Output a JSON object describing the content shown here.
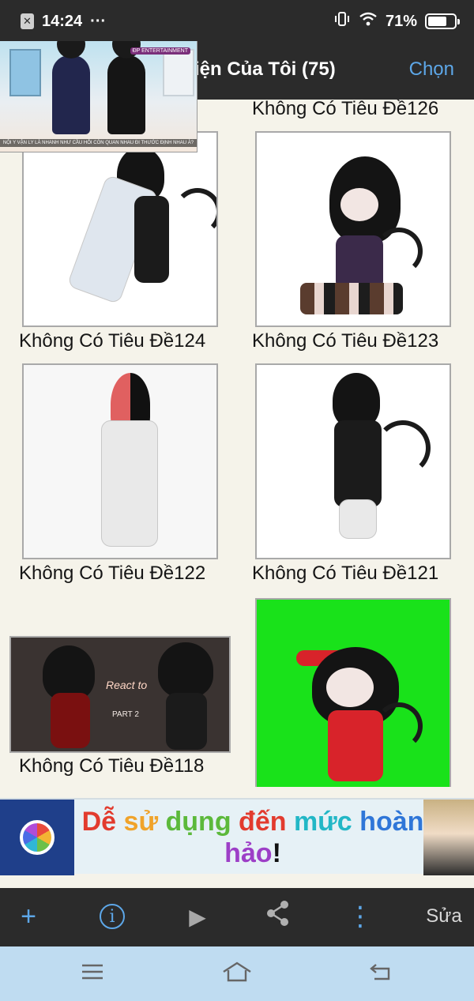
{
  "status_bar": {
    "time": "14:24",
    "more": "···",
    "battery": "71%",
    "battery_level": 0.71,
    "icons": [
      "close-box-icon",
      "vibrate-icon",
      "wifi-icon",
      "battery-icon"
    ]
  },
  "header": {
    "title": "iện Của Tôi (75)",
    "action": "Chọn"
  },
  "pip_video": {
    "logo": "ĐP ENTERTAINMENT",
    "caption": "NỘI Y VẬN LY LÀ NHANH NHƯ CẦU HỎI CÒN QUAN NHAU ĐI THƯỚC ĐỊNH NHAU À?"
  },
  "gallery": {
    "items": [
      {
        "label": "Không Có Tiêu Đề126"
      },
      {
        "label": "Không Có Tiêu Đề124"
      },
      {
        "label": "Không Có Tiêu Đề123"
      },
      {
        "label": "Không Có Tiêu Đề122"
      },
      {
        "label": "Không Có Tiêu Đề121"
      },
      {
        "label": "Không Có Tiêu Đề118"
      },
      {
        "label": "",
        "thumb_color": "#19e21a"
      }
    ],
    "thumb_text": {
      "react": "React to",
      "part": "PART 2"
    }
  },
  "ad": {
    "line1_words": [
      "Dễ",
      "sử",
      "dụng",
      "đến",
      "mức",
      "hoàn"
    ],
    "line2": "hảo",
    "line2_end": "!",
    "word_colors": [
      "#e23b2e",
      "#f0a32a",
      "#5cb93b",
      "#e23b2e",
      "#22b7c6",
      "#2f76d8",
      "#9d3fc7",
      "#111111"
    ]
  },
  "toolbar": {
    "add": "+",
    "info": "i",
    "play": "▶",
    "share": "share",
    "more": "⋮",
    "edit": "Sửa"
  },
  "system_nav": {
    "icons": [
      "menu-icon",
      "home-icon",
      "back-icon"
    ]
  }
}
